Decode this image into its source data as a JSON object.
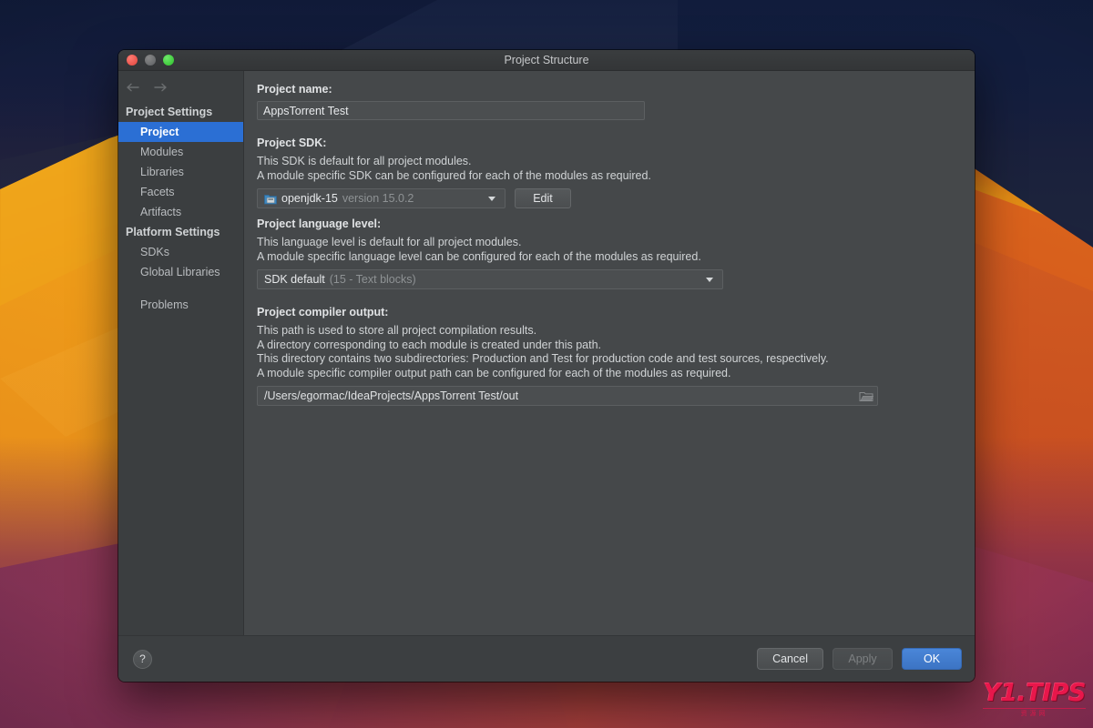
{
  "window": {
    "title": "Project Structure",
    "traffic_lights": [
      "close-button",
      "minimize-button",
      "zoom-button"
    ]
  },
  "sidebar": {
    "nav": {
      "back": "back-arrow",
      "forward": "forward-arrow"
    },
    "groups": [
      {
        "label": "Project Settings",
        "items": [
          {
            "label": "Project",
            "selected": true
          },
          {
            "label": "Modules",
            "selected": false
          },
          {
            "label": "Libraries",
            "selected": false
          },
          {
            "label": "Facets",
            "selected": false
          },
          {
            "label": "Artifacts",
            "selected": false
          }
        ]
      },
      {
        "label": "Platform Settings",
        "items": [
          {
            "label": "SDKs",
            "selected": false
          },
          {
            "label": "Global Libraries",
            "selected": false
          }
        ]
      }
    ],
    "extra_items": [
      {
        "label": "Problems",
        "selected": false
      }
    ]
  },
  "content": {
    "project_name": {
      "label": "Project name:",
      "value": "AppsTorrent Test"
    },
    "project_sdk": {
      "label": "Project SDK:",
      "desc_line1": "This SDK is default for all project modules.",
      "desc_line2": "A module specific SDK can be configured for each of the modules as required.",
      "selected_name": "openjdk-15",
      "selected_detail": "version 15.0.2",
      "edit_label": "Edit"
    },
    "language_level": {
      "label": "Project language level:",
      "desc_line1": "This language level is default for all project modules.",
      "desc_line2": "A module specific language level can be configured for each of the modules as required.",
      "selected_name": "SDK default",
      "selected_detail": "(15 - Text blocks)"
    },
    "compiler_output": {
      "label": "Project compiler output:",
      "desc_line1": "This path is used to store all project compilation results.",
      "desc_line2": "A directory corresponding to each module is created under this path.",
      "desc_line3": "This directory contains two subdirectories: Production and Test for production code and test sources, respectively.",
      "desc_line4": "A module specific compiler output path can be configured for each of the modules as required.",
      "path": "/Users/egormac/IdeaProjects/AppsTorrent Test/out"
    }
  },
  "footer": {
    "help_label": "?",
    "cancel_label": "Cancel",
    "apply_label": "Apply",
    "ok_label": "OK"
  },
  "watermark": {
    "main": "Y1.TIPS",
    "sub": "资源网"
  },
  "colors": {
    "accent_selected": "#2b6fd4",
    "default_button": "#4a86d8",
    "dialog_bg": "#3c3f41",
    "content_bg": "#45484a",
    "sidebar_bg": "#3b3e40",
    "watermark": "#e8174b"
  }
}
